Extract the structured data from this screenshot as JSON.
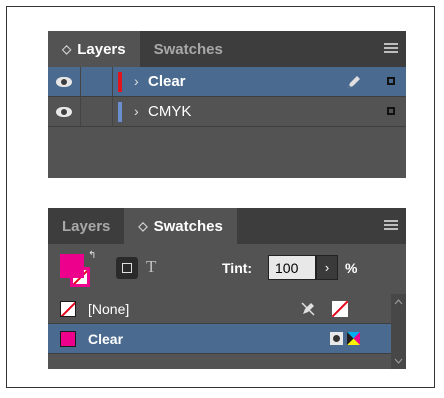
{
  "layers_panel": {
    "tabs": [
      {
        "label": "Layers",
        "active": true
      },
      {
        "label": "Swatches",
        "active": false
      }
    ],
    "rows": [
      {
        "name": "Clear",
        "color": "#e2141c",
        "selected": true
      },
      {
        "name": "CMYK",
        "color": "#6a8fd0",
        "selected": false
      }
    ]
  },
  "swatches_panel": {
    "tabs": [
      {
        "label": "Layers",
        "active": false
      },
      {
        "label": "Swatches",
        "active": true
      }
    ],
    "tint_label": "Tint:",
    "tint_value": "100",
    "percent": "%",
    "text_format_label": "T",
    "swatches": [
      {
        "name": "[None]",
        "selected": false
      },
      {
        "name": "Clear",
        "color": "#ec008c",
        "selected": true
      }
    ]
  },
  "colors": {
    "panel": "#535353",
    "tab_bar": "#3d3d3d",
    "selection": "#4a6b8f",
    "magenta": "#ec008c"
  }
}
